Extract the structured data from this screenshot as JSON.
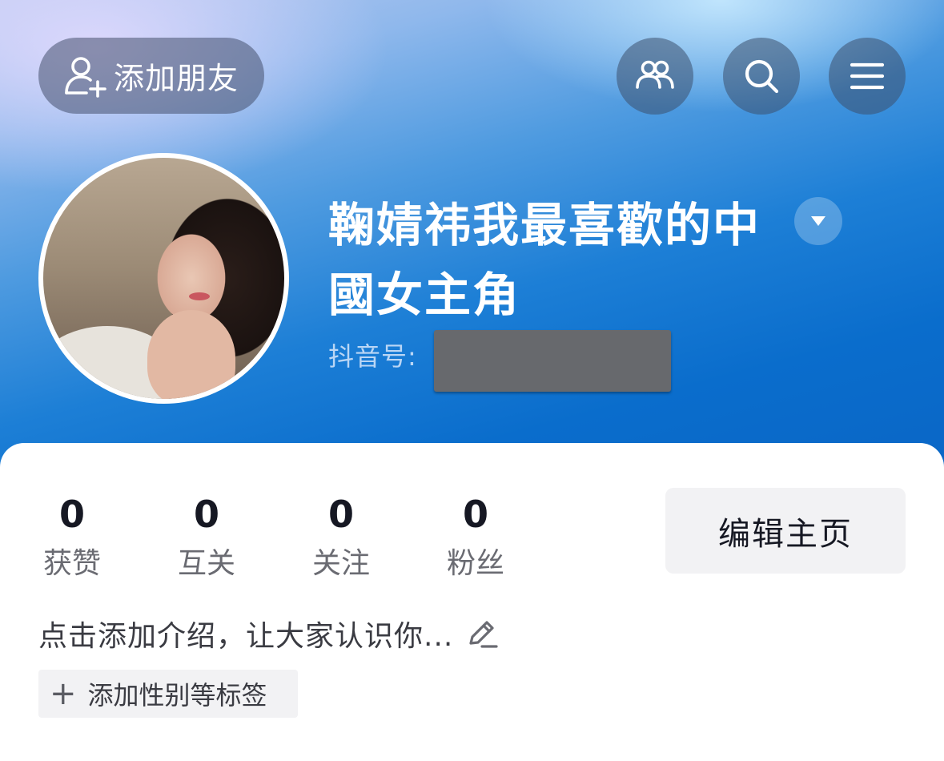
{
  "top_bar": {
    "add_friend_label": "添加朋友",
    "icons": [
      "add-user-icon",
      "friends-icon",
      "search-icon",
      "menu-icon"
    ]
  },
  "profile": {
    "name_line1": "鞠婧祎我最喜歡的中",
    "name_line2": "國女主角",
    "douyin_id_label": "抖音号:"
  },
  "stats": [
    {
      "value": "0",
      "label": "获赞"
    },
    {
      "value": "0",
      "label": "互关"
    },
    {
      "value": "0",
      "label": "关注"
    },
    {
      "value": "0",
      "label": "粉丝"
    }
  ],
  "edit_profile_label": "编辑主页",
  "bio_placeholder": "点击添加介绍，让大家认识你...",
  "add_tags_label": "添加性别等标签",
  "colors": {
    "header_blue": "#0a6dcc",
    "text_primary": "#161823",
    "text_secondary": "#6a6b72",
    "button_bg": "#f2f2f4"
  }
}
